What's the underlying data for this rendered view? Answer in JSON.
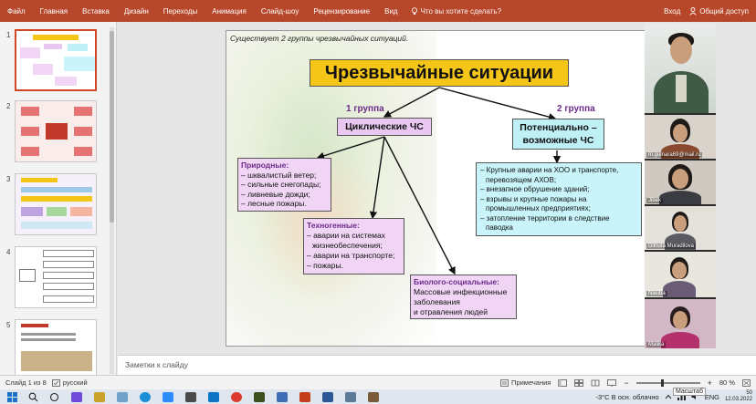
{
  "ribbon": {
    "tabs": [
      "Файл",
      "Главная",
      "Вставка",
      "Дизайн",
      "Переходы",
      "Анимация",
      "Слайд-шоу",
      "Рецензирование",
      "Вид"
    ],
    "tell_me": "Что вы хотите сделать?",
    "sign_in": "Вход",
    "share": "Общий доступ"
  },
  "thumbnails": [
    {
      "num": "1",
      "active": true
    },
    {
      "num": "2",
      "active": false
    },
    {
      "num": "3",
      "active": false
    },
    {
      "num": "4",
      "active": false
    },
    {
      "num": "5",
      "active": false
    }
  ],
  "slide": {
    "note": "Существует 2 группы чрезвычайных ситуаций.",
    "title": "Чрезвычайные ситуации",
    "group1": "1 группа",
    "group2": "2 группа",
    "cyclic": "Циклические ЧС",
    "potential_l1": "Потенциально –",
    "potential_l2": "возможные ЧС",
    "natural": {
      "header": "Природные:",
      "items": [
        "– шквалистый ветер;",
        "– сильные снегопады;",
        "– ливневые дожди;",
        "– лесные пожары."
      ]
    },
    "technogenic": {
      "header": "Техногенные:",
      "items": [
        "– аварии на системах",
        "жизнеобеспечения;",
        "– аварии на транспорте;",
        "– пожары."
      ]
    },
    "biosocial": {
      "header": "Биолого-социальные:",
      "items": [
        "Массовые инфекционные",
        "заболевания",
        "и отравления людей"
      ]
    },
    "potential_list": [
      "– Крупные аварии на ХОО и транспорте,",
      "перевозящем АХОВ;",
      "– внезапное обрушение зданий;",
      "– взрывы и крупные пожары на",
      "промышленных предприятиях;",
      "– затопление территории в следствие",
      "паводка"
    ]
  },
  "video": {
    "participants": [
      "",
      "m.gulnara69@mail.ru",
      "Jibek",
      "Dilnura Muradilova",
      "Nasiba",
      "Malika"
    ]
  },
  "notes": "Заметки к слайду",
  "status": {
    "slide": "Слайд 1 из 8",
    "language": "русский",
    "notes_btn": "Примечания",
    "zoom": "80 %",
    "zoom_level": 0.8,
    "tooltip": "Масштаб"
  },
  "taskbar": {
    "temp": "-3°C  В осн. облачно",
    "lang": "ENG",
    "date": "12.03.2022",
    "time": "50"
  },
  "colors": {
    "ribbon": "#b7472a",
    "title_box": "#f5c518",
    "cyclic_box": "#e8c8f0",
    "potential_box": "#bff0f5"
  }
}
